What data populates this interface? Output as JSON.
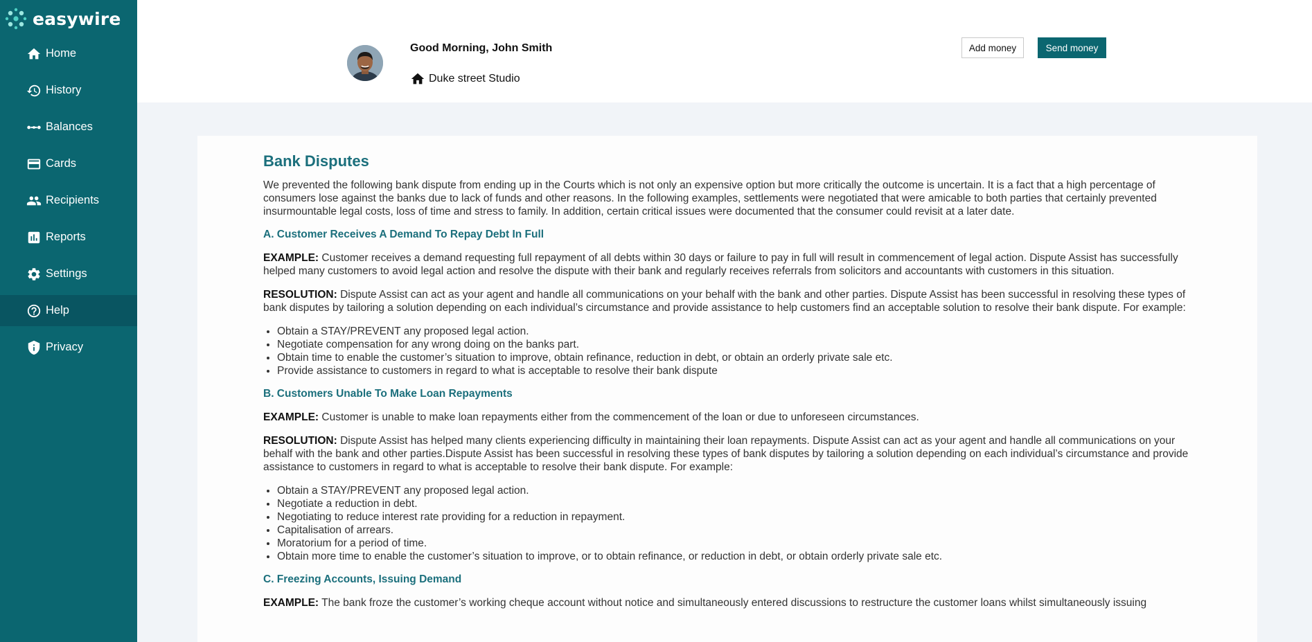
{
  "brand": {
    "name": "easywire"
  },
  "colors": {
    "sidebar": "#0b6670",
    "accent": "#1b6f7c",
    "active_item": "#095561"
  },
  "sidebar": {
    "items": [
      {
        "label": "Home",
        "icon": "home-icon"
      },
      {
        "label": "History",
        "icon": "history-icon"
      },
      {
        "label": "Balances",
        "icon": "balances-icon"
      },
      {
        "label": "Cards",
        "icon": "card-icon"
      },
      {
        "label": "Recipients",
        "icon": "recipients-icon"
      },
      {
        "label": "Reports",
        "icon": "reports-icon"
      },
      {
        "label": "Settings",
        "icon": "gear-icon"
      },
      {
        "label": "Help",
        "icon": "help-icon",
        "active": true
      },
      {
        "label": "Privacy",
        "icon": "shield-icon"
      }
    ]
  },
  "header": {
    "greeting": "Good Morning, John Smith",
    "location": "Duke street Studio",
    "add_money": "Add money",
    "send_money": "Send money"
  },
  "content": {
    "title": "Bank Disputes",
    "intro": "We prevented the following bank dispute from ending up in the Courts which is not only an expensive option but more critically the outcome is uncertain. It is a fact that a high percentage of consumers lose against the banks due to lack of funds and other reasons. In the following examples, settlements were negotiated that were amicable to both parties that certainly prevented insurmountable legal costs, loss of time and stress to family. In addition, certain critical issues were documented that the consumer could revisit at a later date.",
    "sections": [
      {
        "title": "A. Customer Receives A Demand To Repay Debt In Full",
        "example_label": "EXAMPLE:",
        "example": "Customer receives a demand requesting full repayment of all debts within 30 days or failure to pay in full will result in commencement of legal action. Dispute Assist has successfully helped many customers to avoid legal action and resolve the dispute with their bank and regularly receives referrals from solicitors and accountants with customers in this situation.",
        "resolution_label": "RESOLUTION:",
        "resolution": "Dispute Assist can act as your agent and handle all communications on your behalf with the bank and other parties. Dispute Assist has been successful in resolving these types of bank disputes by tailoring a solution depending on each individual’s circumstance and provide assistance to help customers find an acceptable solution to resolve their bank dispute. For example:",
        "bullets": [
          "Obtain a STAY/PREVENT any proposed legal action.",
          "Negotiate compensation for any wrong doing on the banks part.",
          "Obtain time to enable the customer’s situation to improve, obtain refinance, reduction in debt, or obtain an orderly private sale etc.",
          "Provide assistance to customers in regard to what is acceptable to resolve their bank dispute"
        ]
      },
      {
        "title": "B. Customers Unable To Make Loan Repayments",
        "example_label": "EXAMPLE:",
        "example": "Customer is unable to make loan repayments either from the commencement of the loan or due to unforeseen circumstances.",
        "resolution_label": "RESOLUTION:",
        "resolution": "Dispute Assist has helped many clients experiencing difficulty in maintaining their loan repayments. Dispute Assist can act as your agent and handle all communications on your behalf with the bank and other parties.Dispute Assist has been successful in resolving these types of bank disputes by tailoring a solution depending on each individual’s circumstance and provide assistance to customers in regard to what is acceptable to resolve their bank dispute. For example:",
        "bullets": [
          "Obtain a STAY/PREVENT any proposed legal action.",
          "Negotiate a reduction in debt.",
          "Negotiating to reduce interest rate providing for a reduction in repayment.",
          "Capitalisation of arrears.",
          "Moratorium for a period of time.",
          "Obtain more time to enable the customer’s situation to improve, or to obtain refinance, or reduction in debt, or obtain orderly private sale etc."
        ]
      },
      {
        "title": "C. Freezing Accounts, Issuing Demand",
        "example_label": "EXAMPLE:",
        "example": "The bank froze the customer’s working cheque account without notice and simultaneously entered discussions to restructure the customer loans whilst simultaneously issuing"
      }
    ]
  }
}
